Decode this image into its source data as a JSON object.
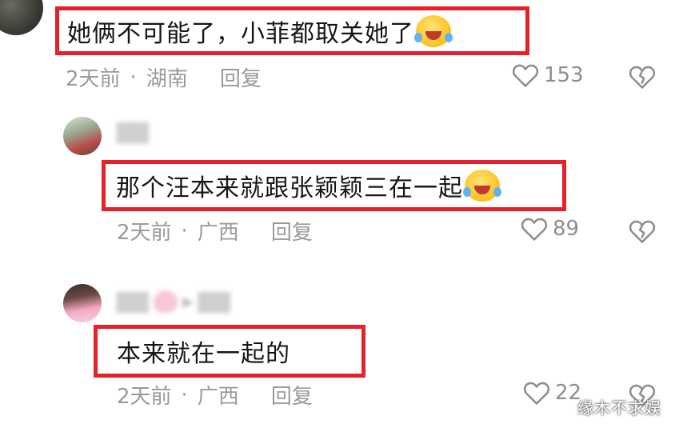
{
  "comments": [
    {
      "text": "她俩不可能了，小菲都取关她了",
      "time": "2天前",
      "separator": "·",
      "location": "湖南",
      "reply_label": "回复",
      "likes": "153"
    },
    {
      "text": "那个汪本来就跟张颖颖三在一起",
      "time": "2天前",
      "separator": "·",
      "location": "广西",
      "reply_label": "回复",
      "likes": "89"
    },
    {
      "text": "本来就在一起的",
      "time": "2天前",
      "separator": "·",
      "location": "广西",
      "reply_label": "回复",
      "likes": "22"
    }
  ],
  "watermark": "缘木不求娱",
  "colors": {
    "highlight_border": "#e5212c",
    "meta_text": "#9a9a9a",
    "background": "#ffffff"
  },
  "icons": [
    "laughing-crying-emoji",
    "heart-outline-icon",
    "broken-heart-icon",
    "pink-heart-emoji",
    "reply-arrow-icon"
  ]
}
